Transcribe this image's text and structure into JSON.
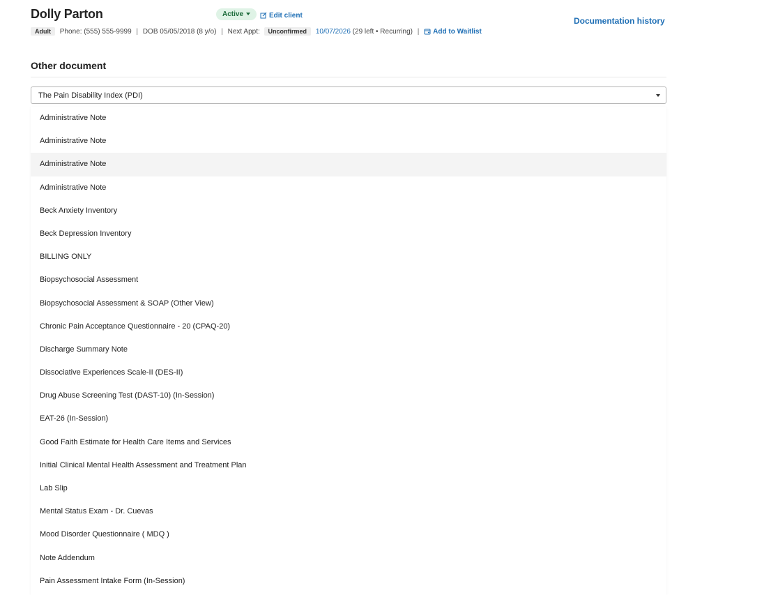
{
  "client": {
    "name": "Dolly Parton",
    "status": "Active",
    "edit_label": "Edit client",
    "type_badge": "Adult",
    "phone": "Phone: (555) 555-9999",
    "dob": "DOB 05/05/2018 (8 y/o)",
    "next_appt_label": "Next Appt:",
    "appt_status": "Unconfirmed",
    "appt_date": "10/07/2026",
    "appt_detail": "(29 left • Recurring)",
    "waitlist_label": "Add to Waitlist",
    "doc_history_label": "Documentation history"
  },
  "section": {
    "title": "Other document"
  },
  "select": {
    "value": "The Pain Disability Index (PDI)"
  },
  "options": [
    "Administrative Note",
    "Administrative Note",
    "Administrative Note",
    "Administrative Note",
    "Beck Anxiety Inventory",
    "Beck Depression Inventory",
    "BILLING ONLY",
    "Biopsychosocial Assessment",
    "Biopsychosocial Assessment & SOAP (Other View)",
    "Chronic Pain Acceptance Questionnaire - 20 (CPAQ-20)",
    "Discharge Summary Note",
    "Dissociative Experiences Scale-II (DES-II)",
    "Drug Abuse Screening Test (DAST-10) (In-Session)",
    "EAT-26 (In-Session)",
    "Good Faith Estimate for Health Care Items and Services",
    "Initial Clinical Mental Health Assessment and Treatment Plan",
    "Lab Slip",
    "Mental Status Exam - Dr. Cuevas",
    "Mood Disorder Questionnaire ( MDQ )",
    "Note Addendum",
    "Pain Assessment Intake Form (In-Session)"
  ],
  "icons": {
    "edit": "edit-icon",
    "waitlist": "calendar-add-icon",
    "status_caret": "caret-down-icon",
    "select_caret": "caret-down-icon"
  },
  "colors": {
    "link": "#1f6fb5",
    "status_bg": "#dff3e6",
    "status_text": "#1a6a39",
    "hover_bg": "#f4f4f4"
  }
}
